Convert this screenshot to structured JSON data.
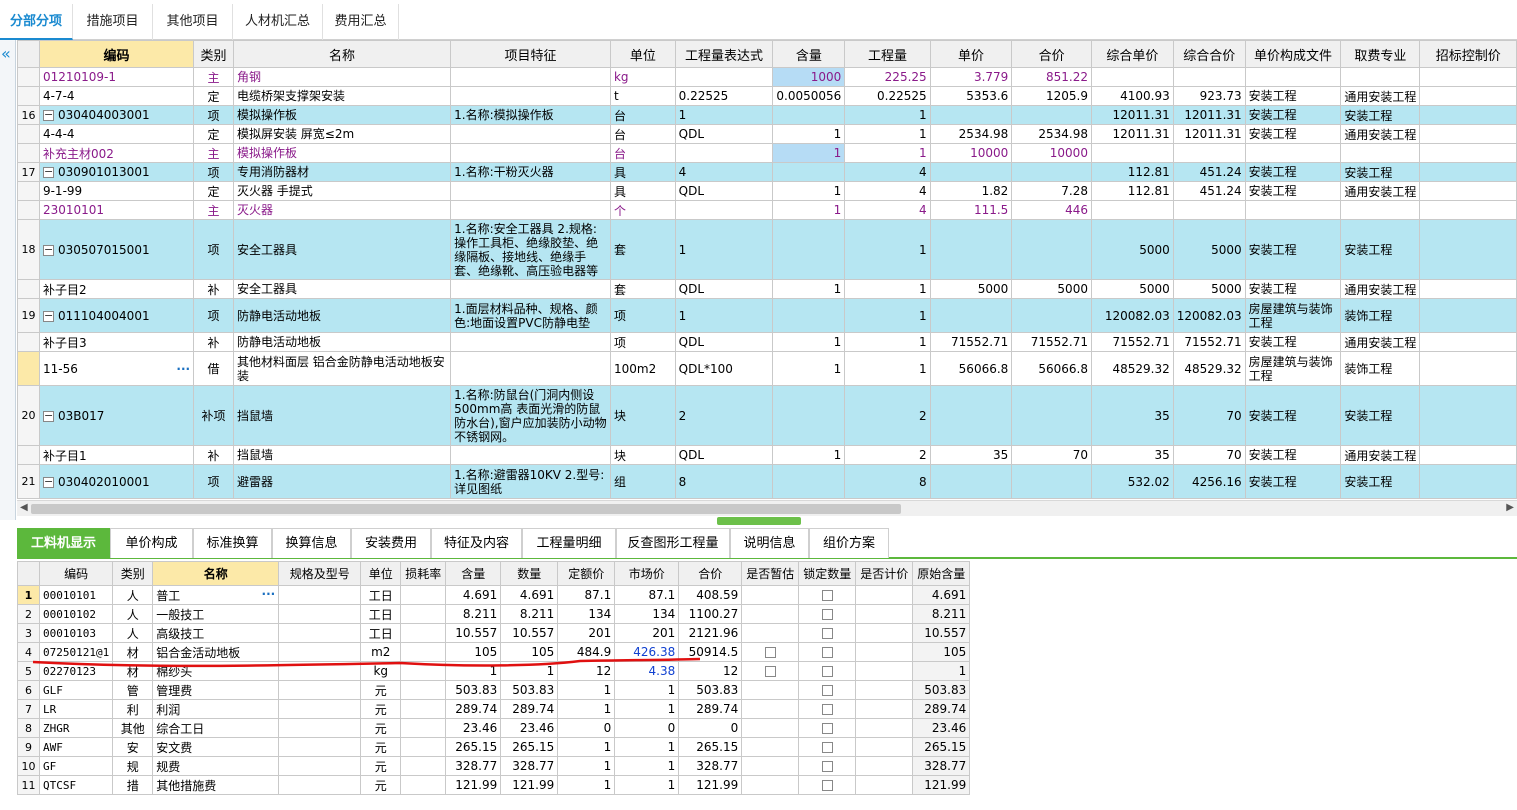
{
  "top_tabs": [
    "分部分项",
    "措施项目",
    "其他项目",
    "人材机汇总",
    "费用汇总"
  ],
  "upper": {
    "headers": [
      "编码",
      "类别",
      "名称",
      "项目特征",
      "单位",
      "工程量表达式",
      "含量",
      "工程量",
      "单价",
      "合价",
      "综合单价",
      "综合合价",
      "单价构成文件",
      "取费专业",
      "招标控制价"
    ],
    "rows": [
      {
        "num": "",
        "code": "01210109-1",
        "type": "主",
        "name": "角钢",
        "feature": "",
        "unit": "kg",
        "expr": "",
        "content": "1000",
        "qty": "225.25",
        "price": "3.779",
        "total": "851.22",
        "cprice": "",
        "ctotal": "",
        "file": "",
        "major": "",
        "ctrl": ""
      },
      {
        "num": "",
        "code": "4-7-4",
        "type": "定",
        "name": "电缆桥架支撑架安装",
        "feature": "",
        "unit": "t",
        "expr": "0.22525",
        "content": "0.0050056",
        "qty": "0.22525",
        "price": "5353.6",
        "total": "1205.9",
        "cprice": "4100.93",
        "ctotal": "923.73",
        "file": "安装工程",
        "major": "通用安装工程",
        "ctrl": ""
      },
      {
        "num": "16",
        "code": "030404003001",
        "type": "项",
        "name": "模拟操作板",
        "feature": "1.名称:模拟操作板",
        "unit": "台",
        "expr": "1",
        "content": "",
        "qty": "1",
        "price": "",
        "total": "",
        "cprice": "12011.31",
        "ctotal": "12011.31",
        "file": "安装工程",
        "major": "安装工程",
        "ctrl": ""
      },
      {
        "num": "",
        "code": "4-4-4",
        "type": "定",
        "name": "模拟屏安装 屏宽≤2m",
        "feature": "",
        "unit": "台",
        "expr": "QDL",
        "content": "1",
        "qty": "1",
        "price": "2534.98",
        "total": "2534.98",
        "cprice": "12011.31",
        "ctotal": "12011.31",
        "file": "安装工程",
        "major": "通用安装工程",
        "ctrl": ""
      },
      {
        "num": "",
        "code": "补充主材002",
        "type": "主",
        "name": "模拟操作板",
        "feature": "",
        "unit": "台",
        "expr": "",
        "content": "1",
        "qty": "1",
        "price": "10000",
        "total": "10000",
        "cprice": "",
        "ctotal": "",
        "file": "",
        "major": "",
        "ctrl": ""
      },
      {
        "num": "17",
        "code": "030901013001",
        "type": "项",
        "name": "专用消防器材",
        "feature": "1.名称:干粉灭火器",
        "unit": "具",
        "expr": "4",
        "content": "",
        "qty": "4",
        "price": "",
        "total": "",
        "cprice": "112.81",
        "ctotal": "451.24",
        "file": "安装工程",
        "major": "安装工程",
        "ctrl": ""
      },
      {
        "num": "",
        "code": "9-1-99",
        "type": "定",
        "name": "灭火器 手提式",
        "feature": "",
        "unit": "具",
        "expr": "QDL",
        "content": "1",
        "qty": "4",
        "price": "1.82",
        "total": "7.28",
        "cprice": "112.81",
        "ctotal": "451.24",
        "file": "安装工程",
        "major": "通用安装工程",
        "ctrl": ""
      },
      {
        "num": "",
        "code": "23010101",
        "type": "主",
        "name": "灭火器",
        "feature": "",
        "unit": "个",
        "expr": "",
        "content": "1",
        "qty": "4",
        "price": "111.5",
        "total": "446",
        "cprice": "",
        "ctotal": "",
        "file": "",
        "major": "",
        "ctrl": ""
      },
      {
        "num": "18",
        "code": "030507015001",
        "type": "项",
        "name": "安全工器具",
        "feature": "1.名称:安全工器具\n2.规格:操作工具柜、绝缘胶垫、绝缘隔板、接地线、绝缘手套、绝缘靴、高压验电器等",
        "unit": "套",
        "expr": "1",
        "content": "",
        "qty": "1",
        "price": "",
        "total": "",
        "cprice": "5000",
        "ctotal": "5000",
        "file": "安装工程",
        "major": "安装工程",
        "ctrl": ""
      },
      {
        "num": "",
        "code": "补子目2",
        "type": "补",
        "name": "安全工器具",
        "feature": "",
        "unit": "套",
        "expr": "QDL",
        "content": "1",
        "qty": "1",
        "price": "5000",
        "total": "5000",
        "cprice": "5000",
        "ctotal": "5000",
        "file": "安装工程",
        "major": "通用安装工程",
        "ctrl": ""
      },
      {
        "num": "19",
        "code": "011104004001",
        "type": "项",
        "name": "防静电活动地板",
        "feature": "1.面层材料品种、规格、颜色:地面设置PVC防静电垫",
        "unit": "项",
        "expr": "1",
        "content": "",
        "qty": "1",
        "price": "",
        "total": "",
        "cprice": "120082.03",
        "ctotal": "120082.03",
        "file": "房屋建筑与装饰工程",
        "major": "装饰工程",
        "ctrl": ""
      },
      {
        "num": "",
        "code": "补子目3",
        "type": "补",
        "name": "防静电活动地板",
        "feature": "",
        "unit": "项",
        "expr": "QDL",
        "content": "1",
        "qty": "1",
        "price": "71552.71",
        "total": "71552.71",
        "cprice": "71552.71",
        "ctotal": "71552.71",
        "file": "安装工程",
        "major": "通用安装工程",
        "ctrl": ""
      },
      {
        "num": "",
        "code": "11-56",
        "type": "借",
        "name": "其他材料面层 铝合金防静电活动地板安装",
        "feature": "",
        "unit": "100m2",
        "expr": "QDL*100",
        "content": "1",
        "qty": "1",
        "price": "56066.8",
        "total": "56066.8",
        "cprice": "48529.32",
        "ctotal": "48529.32",
        "file": "房屋建筑与装饰工程",
        "major": "装饰工程",
        "ctrl": ""
      },
      {
        "num": "20",
        "code": "03B017",
        "type": "补项",
        "name": "挡鼠墙",
        "feature": "1.名称:防鼠台(门洞内侧设500mm高\n表面光滑的防鼠防水台),窗户应加装防小动物不锈钢网。",
        "unit": "块",
        "expr": "2",
        "content": "",
        "qty": "2",
        "price": "",
        "total": "",
        "cprice": "35",
        "ctotal": "70",
        "file": "安装工程",
        "major": "安装工程",
        "ctrl": ""
      },
      {
        "num": "",
        "code": "补子目1",
        "type": "补",
        "name": "挡鼠墙",
        "feature": "",
        "unit": "块",
        "expr": "QDL",
        "content": "1",
        "qty": "2",
        "price": "35",
        "total": "70",
        "cprice": "35",
        "ctotal": "70",
        "file": "安装工程",
        "major": "通用安装工程",
        "ctrl": ""
      },
      {
        "num": "21",
        "code": "030402010001",
        "type": "项",
        "name": "避雷器",
        "feature": "1.名称:避雷器10KV\n2.型号:详见图纸",
        "unit": "组",
        "expr": "8",
        "content": "",
        "qty": "8",
        "price": "",
        "total": "",
        "cprice": "532.02",
        "ctotal": "4256.16",
        "file": "安装工程",
        "major": "安装工程",
        "ctrl": ""
      }
    ]
  },
  "bottom_tabs": [
    "工料机显示",
    "单价构成",
    "标准换算",
    "换算信息",
    "安装费用",
    "特征及内容",
    "工程量明细",
    "反查图形工程量",
    "说明信息",
    "组价方案"
  ],
  "lower": {
    "headers": [
      "编码",
      "类别",
      "名称",
      "规格及型号",
      "单位",
      "损耗率",
      "含量",
      "数量",
      "定额价",
      "市场价",
      "合价",
      "是否暂估",
      "锁定数量",
      "是否计价",
      "原始含量"
    ],
    "rows": [
      {
        "n": "1",
        "code": "00010101",
        "type": "人",
        "name": "普工",
        "spec": "",
        "unit": "工日",
        "loss": "",
        "content": "4.691",
        "qty": "4.691",
        "dprice": "87.1",
        "mprice": "87.1",
        "total": "408.59",
        "orig": "4.691"
      },
      {
        "n": "2",
        "code": "00010102",
        "type": "人",
        "name": "一般技工",
        "spec": "",
        "unit": "工日",
        "loss": "",
        "content": "8.211",
        "qty": "8.211",
        "dprice": "134",
        "mprice": "134",
        "total": "1100.27",
        "orig": "8.211"
      },
      {
        "n": "3",
        "code": "00010103",
        "type": "人",
        "name": "高级技工",
        "spec": "",
        "unit": "工日",
        "loss": "",
        "content": "10.557",
        "qty": "10.557",
        "dprice": "201",
        "mprice": "201",
        "total": "2121.96",
        "orig": "10.557"
      },
      {
        "n": "4",
        "code": "07250121@1",
        "type": "材",
        "name": "铝合金活动地板",
        "spec": "",
        "unit": "m2",
        "loss": "",
        "content": "105",
        "qty": "105",
        "dprice": "484.9",
        "mprice": "426.38",
        "total": "50914.5",
        "orig": "105"
      },
      {
        "n": "5",
        "code": "02270123",
        "type": "材",
        "name": "棉纱头",
        "spec": "",
        "unit": "kg",
        "loss": "",
        "content": "1",
        "qty": "1",
        "dprice": "12",
        "mprice": "4.38",
        "total": "12",
        "orig": "1"
      },
      {
        "n": "6",
        "code": "GLF",
        "type": "管",
        "name": "管理费",
        "spec": "",
        "unit": "元",
        "loss": "",
        "content": "503.83",
        "qty": "503.83",
        "dprice": "1",
        "mprice": "1",
        "total": "503.83",
        "orig": "503.83"
      },
      {
        "n": "7",
        "code": "LR",
        "type": "利",
        "name": "利润",
        "spec": "",
        "unit": "元",
        "loss": "",
        "content": "289.74",
        "qty": "289.74",
        "dprice": "1",
        "mprice": "1",
        "total": "289.74",
        "orig": "289.74"
      },
      {
        "n": "8",
        "code": "ZHGR",
        "type": "其他",
        "name": "综合工日",
        "spec": "",
        "unit": "元",
        "loss": "",
        "content": "23.46",
        "qty": "23.46",
        "dprice": "0",
        "mprice": "0",
        "total": "0",
        "orig": "23.46"
      },
      {
        "n": "9",
        "code": "AWF",
        "type": "安",
        "name": "安文费",
        "spec": "",
        "unit": "元",
        "loss": "",
        "content": "265.15",
        "qty": "265.15",
        "dprice": "1",
        "mprice": "1",
        "total": "265.15",
        "orig": "265.15"
      },
      {
        "n": "10",
        "code": "GF",
        "type": "规",
        "name": "规费",
        "spec": "",
        "unit": "元",
        "loss": "",
        "content": "328.77",
        "qty": "328.77",
        "dprice": "1",
        "mprice": "1",
        "total": "328.77",
        "orig": "328.77"
      },
      {
        "n": "11",
        "code": "QTCSF",
        "type": "措",
        "name": "其他措施费",
        "spec": "",
        "unit": "元",
        "loss": "",
        "content": "121.99",
        "qty": "121.99",
        "dprice": "1",
        "mprice": "1",
        "total": "121.99",
        "orig": "121.99"
      }
    ]
  },
  "icons": {
    "collapse": "chevron-left-icon",
    "expand": "tree-minus-icon",
    "ellipsis": "ellipsis-icon"
  },
  "colors": {
    "accent": "#1a8ad0",
    "item_row": "#b6e6f2",
    "tab_green": "#5cb83c",
    "highlight": "#fce9a8",
    "annotation_red": "#e01010"
  }
}
